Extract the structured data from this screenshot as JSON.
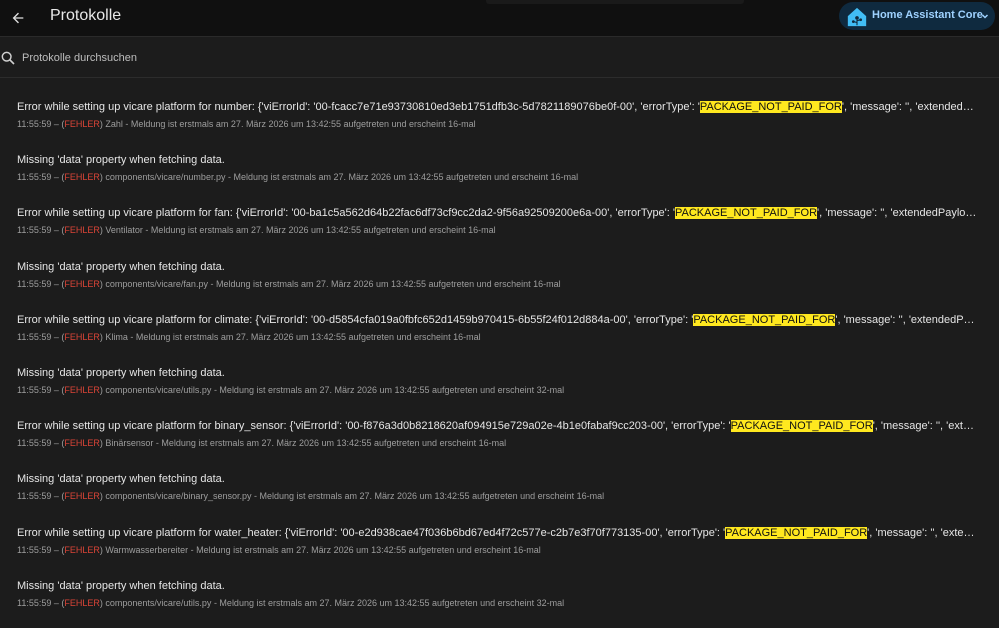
{
  "header": {
    "title": "Protokolle",
    "instance_label": "Home Assistant Core"
  },
  "search": {
    "placeholder": "Protokolle durchsuchen"
  },
  "entries": [
    {
      "pre": "Error while setting up vicare platform for number: {'viErrorId': '00-fcacc7e71e93730810ed3eb1751dfb3c-5d7821189076be0f-00', 'errorType': '",
      "hl": "PACKAGE_NOT_PAID_FOR",
      "post": "', 'message': '', 'extendedPayload': {'mo...",
      "time": "11:55:59 – (",
      "level": "FEHLER",
      "source": ") Zahl - Meldung ist erstmals am 27. März 2026 um 13:42:55 aufgetreten und erscheint 16-mal"
    },
    {
      "pre": "Missing 'data' property when fetching data.",
      "hl": "",
      "post": "",
      "time": "11:55:59 – (",
      "level": "FEHLER",
      "source": ") components/vicare/number.py - Meldung ist erstmals am 27. März 2026 um 13:42:55 aufgetreten und erscheint 16-mal"
    },
    {
      "pre": "Error while setting up vicare platform for fan: {'viErrorId': '00-ba1c5a562d64b22fac6df73cf9cc2da2-9f56a92509200e6a-00', 'errorType': '",
      "hl": "PACKAGE_NOT_PAID_FOR",
      "post": "', 'message': '', 'extendedPayload': {'monetiz...",
      "time": "11:55:59 – (",
      "level": "FEHLER",
      "source": ") Ventilator - Meldung ist erstmals am 27. März 2026 um 13:42:55 aufgetreten und erscheint 16-mal"
    },
    {
      "pre": "Missing 'data' property when fetching data.",
      "hl": "",
      "post": "",
      "time": "11:55:59 – (",
      "level": "FEHLER",
      "source": ") components/vicare/fan.py - Meldung ist erstmals am 27. März 2026 um 13:42:55 aufgetreten und erscheint 16-mal"
    },
    {
      "pre": "Error while setting up vicare platform for climate: {'viErrorId': '00-d5854cfa019a0fbfc652d1459b970415-6b55f24f012d884a-00', 'errorType': '",
      "hl": "PACKAGE_NOT_PAID_FOR",
      "post": "', 'message': '', 'extendedPayload': {'mon...",
      "time": "11:55:59 – (",
      "level": "FEHLER",
      "source": ") Klima - Meldung ist erstmals am 27. März 2026 um 13:42:55 aufgetreten und erscheint 16-mal"
    },
    {
      "pre": "Missing 'data' property when fetching data.",
      "hl": "",
      "post": "",
      "time": "11:55:59 – (",
      "level": "FEHLER",
      "source": ") components/vicare/utils.py - Meldung ist erstmals am 27. März 2026 um 13:42:55 aufgetreten und erscheint 32-mal"
    },
    {
      "pre": "Error while setting up vicare platform for binary_sensor: {'viErrorId': '00-f876a3d0b8218620af094915e729a02e-4b1e0fabaf9cc203-00', 'errorType': '",
      "hl": "PACKAGE_NOT_PAID_FOR",
      "post": "', 'message': '', 'extendedPayload'...",
      "time": "11:55:59 – (",
      "level": "FEHLER",
      "source": ") Binärsensor - Meldung ist erstmals am 27. März 2026 um 13:42:55 aufgetreten und erscheint 16-mal"
    },
    {
      "pre": "Missing 'data' property when fetching data.",
      "hl": "",
      "post": "",
      "time": "11:55:59 – (",
      "level": "FEHLER",
      "source": ") components/vicare/binary_sensor.py - Meldung ist erstmals am 27. März 2026 um 13:42:55 aufgetreten und erscheint 16-mal"
    },
    {
      "pre": "Error while setting up vicare platform for water_heater: {'viErrorId': '00-e2d938cae47f036b6bd67ed4f72c577e-c2b7e3f70f773135-00', 'errorType': '",
      "hl": "PACKAGE_NOT_PAID_FOR",
      "post": "', 'message': '', 'extendedPayload': ...",
      "time": "11:55:59 – (",
      "level": "FEHLER",
      "source": ") Warmwasserbereiter - Meldung ist erstmals am 27. März 2026 um 13:42:55 aufgetreten und erscheint 16-mal"
    },
    {
      "pre": "Missing 'data' property when fetching data.",
      "hl": "",
      "post": "",
      "time": "11:55:59 – (",
      "level": "FEHLER",
      "source": ") components/vicare/utils.py - Meldung ist erstmals am 27. März 2026 um 13:42:55 aufgetreten und erscheint 32-mal"
    }
  ],
  "icons": {
    "back": "arrow-left-icon",
    "search": "magnify-icon",
    "logo": "home-assistant-logo",
    "chevron": "chevron-down-icon"
  },
  "colors": {
    "background": "#1c1c1c",
    "header_bg": "#101010",
    "highlight": "#ffe81f",
    "error": "#db4437",
    "pill_bg": "#0f2a3f",
    "pill_text": "#9fd2ff"
  }
}
